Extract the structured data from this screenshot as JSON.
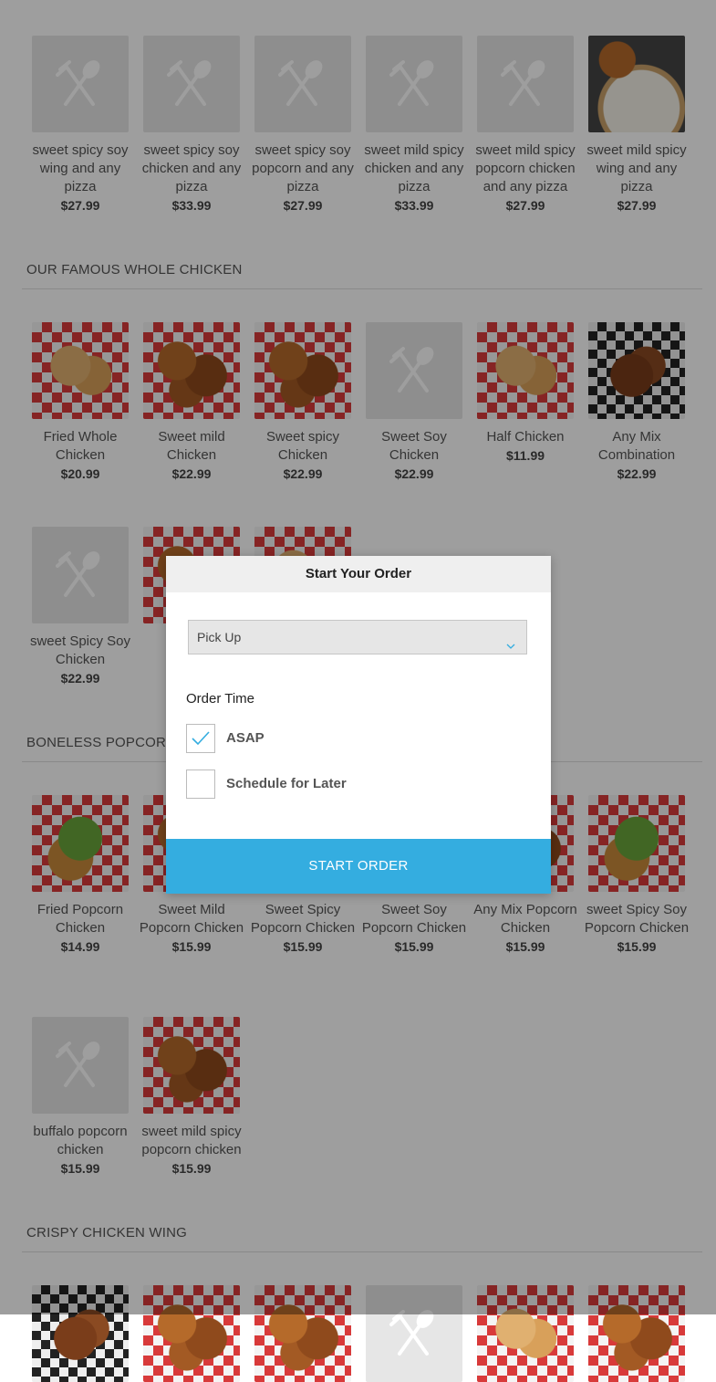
{
  "menu": {
    "pizza_combo": {
      "items": [
        {
          "name": "sweet spicy soy wing and any pizza",
          "price": "$27.99",
          "image": "placeholder"
        },
        {
          "name": "sweet spicy soy chicken and any pizza",
          "price": "$33.99",
          "image": "placeholder"
        },
        {
          "name": "sweet spicy soy popcorn and any pizza",
          "price": "$27.99",
          "image": "placeholder"
        },
        {
          "name": "sweet mild spicy chicken and any pizza",
          "price": "$33.99",
          "image": "placeholder"
        },
        {
          "name": "sweet mild spicy popcorn chicken and any pizza",
          "price": "$27.99",
          "image": "placeholder"
        },
        {
          "name": "sweet mild spicy wing and any pizza",
          "price": "$27.99",
          "image": "photo"
        }
      ]
    },
    "whole_chicken": {
      "title": "OUR FAMOUS WHOLE CHICKEN",
      "items": [
        {
          "name": "Fried Whole Chicken",
          "price": "$20.99",
          "image": "photo"
        },
        {
          "name": "Sweet mild Chicken",
          "price": "$22.99",
          "image": "photo"
        },
        {
          "name": "Sweet spicy Chicken",
          "price": "$22.99",
          "image": "photo"
        },
        {
          "name": "Sweet Soy Chicken",
          "price": "$22.99",
          "image": "placeholder"
        },
        {
          "name": "Half Chicken",
          "price": "$11.99",
          "image": "photo"
        },
        {
          "name": "Any Mix Combination",
          "price": "$22.99",
          "image": "photo"
        },
        {
          "name": "sweet Spicy Soy Chicken",
          "price": "$22.99",
          "image": "placeholder"
        }
      ]
    },
    "popcorn": {
      "title": "BONELESS POPCORN",
      "items": [
        {
          "name": "Fried Popcorn Chicken",
          "price": "$14.99",
          "image": "photo"
        },
        {
          "name": "Sweet Mild Popcorn Chicken",
          "price": "$15.99",
          "image": "photo"
        },
        {
          "name": "Sweet Spicy Popcorn Chicken",
          "price": "$15.99",
          "image": "photo"
        },
        {
          "name": "Sweet Soy Popcorn Chicken",
          "price": "$15.99",
          "image": "photo"
        },
        {
          "name": "Any Mix Popcorn Chicken",
          "price": "$15.99",
          "image": "photo"
        },
        {
          "name": "sweet Spicy Soy Popcorn Chicken",
          "price": "$15.99",
          "image": "photo"
        },
        {
          "name": "buffalo popcorn chicken",
          "price": "$15.99",
          "image": "placeholder"
        },
        {
          "name": "sweet mild spicy popcorn chicken",
          "price": "$15.99",
          "image": "photo"
        }
      ]
    },
    "wings": {
      "title": "CRISPY CHICKEN WING"
    }
  },
  "modal": {
    "title": "Start Your Order",
    "order_type": "Pick Up",
    "order_time_label": "Order Time",
    "options": [
      {
        "label": "ASAP",
        "checked": true
      },
      {
        "label": "Schedule for Later",
        "checked": false
      }
    ],
    "start_button": "START ORDER"
  },
  "colors": {
    "accent": "#34ade0",
    "overlay": "rgba(0,0,0,0.38)"
  }
}
